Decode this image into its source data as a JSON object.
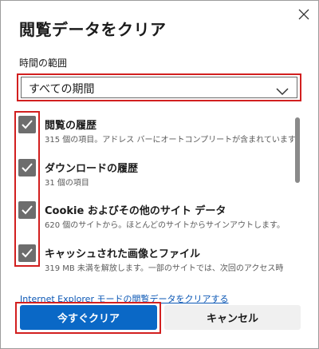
{
  "dialog": {
    "title": "閲覧データをクリア",
    "close_icon": "close-icon"
  },
  "time_range": {
    "label": "時間の範囲",
    "selected": "すべての期間",
    "chevron_icon": "chevron-down-icon"
  },
  "items": [
    {
      "title": "閲覧の履歴",
      "desc": "315 個の項目。アドレス バーにオートコンプリートが含まれています。",
      "checked": true
    },
    {
      "title": "ダウンロードの履歴",
      "desc": "31 個の項目",
      "checked": true
    },
    {
      "title": "Cookie およびその他のサイト データ",
      "desc": "620 個のサイトから。ほとんどのサイトからサインアウトします。",
      "checked": true
    },
    {
      "title": "キャッシュされた画像とファイル",
      "desc": "319 MB 未満を解放します。一部のサイトでは、次回のアクセス時",
      "checked": true
    }
  ],
  "ie_link": "Internet Explorer モードの閲覧データをクリアする",
  "buttons": {
    "clear_now": "今すぐクリア",
    "cancel": "キャンセル"
  },
  "colors": {
    "accent": "#0a68c6",
    "highlight": "#d21f1f",
    "checkbox": "#6d6d6d"
  }
}
